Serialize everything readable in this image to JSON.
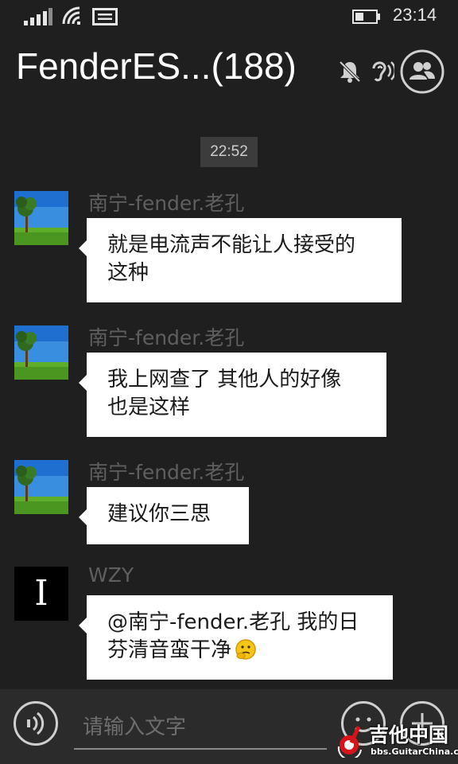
{
  "status_bar": {
    "time": "23:14",
    "icons": [
      "signal-icon",
      "wifi-icon",
      "message-icon",
      "battery-icon"
    ]
  },
  "header": {
    "title": "FenderES...(188)",
    "icons": [
      "mute-icon",
      "earpiece-icon",
      "group-members-icon"
    ]
  },
  "conversation": {
    "timestamp": "22:52",
    "messages": [
      {
        "sender": "南宁-fender.老孔",
        "avatar": "landscape-tree",
        "lines": [
          "就是电流声不能让人接受的",
          "这种"
        ]
      },
      {
        "sender": "南宁-fender.老孔",
        "avatar": "landscape-tree",
        "lines": [
          "我上网查了 其他人的好像",
          "也是这样"
        ]
      },
      {
        "sender": "南宁-fender.老孔",
        "avatar": "landscape-tree",
        "lines": [
          "建议你三思"
        ]
      },
      {
        "sender": "WZY",
        "avatar_text": "I",
        "lines": [
          "@南宁-fender.老孔 我的日",
          "芬清音蛮干净"
        ],
        "emoji": "thinking-face-emoji"
      }
    ]
  },
  "input_bar": {
    "placeholder": "请输入文字",
    "icons": [
      "voice-icon",
      "emoji-icon",
      "plus-icon"
    ]
  },
  "watermark": {
    "title": "吉他中国",
    "url": "bbs.GuitarChina.com"
  },
  "colors": {
    "background": "#1f1f1f",
    "bubble": "#ffffff",
    "sender_text": "#5f5f5f",
    "input_bar": "#2b2b2b"
  }
}
